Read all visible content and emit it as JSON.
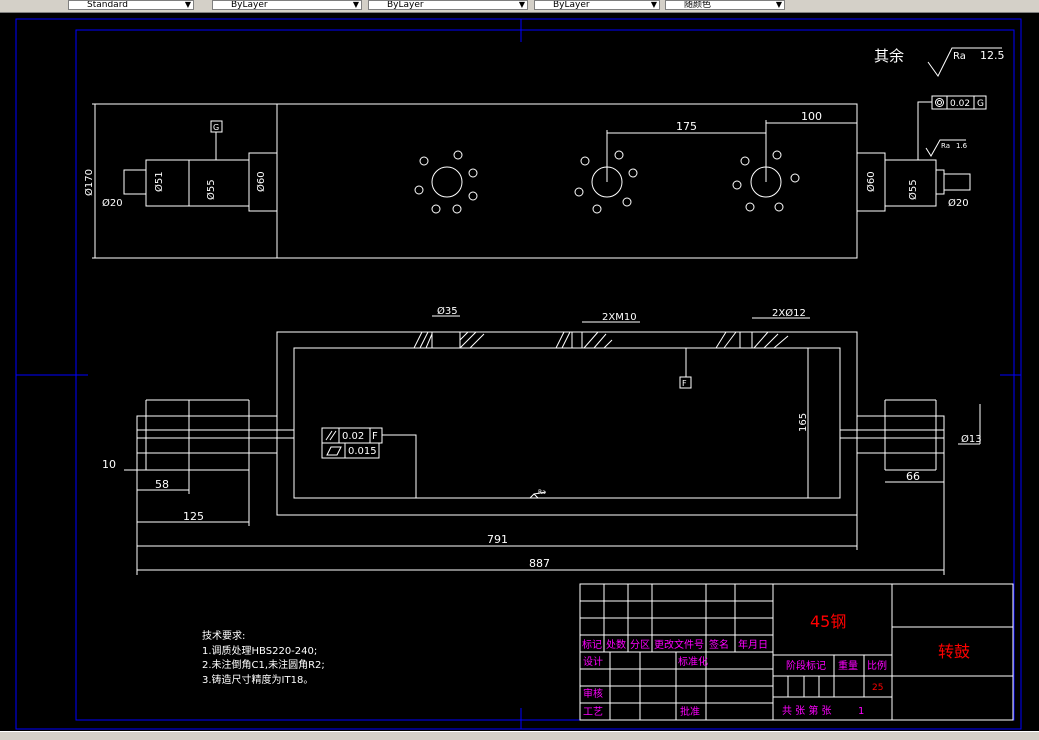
{
  "toolbar": {
    "combo1": "Standard",
    "combo2": "ByLayer",
    "combo3": "ByLayer",
    "combo4": "ByLayer",
    "combo5": "随颜色"
  },
  "roughness": {
    "other_label": "其余",
    "symbol": "Ra",
    "value": "12.5",
    "symbol2": "Ra",
    "value2": "1.6"
  },
  "datums": {
    "g": "G",
    "f": "F"
  },
  "top_view": {
    "d170": "Ø170",
    "d20_left": "Ø20",
    "d51": "Ø51",
    "d55_left": "Ø55",
    "d60_left": "Ø60",
    "d60_right": "Ø60",
    "d55_right": "Ø55",
    "d20_right": "Ø20",
    "spacing": "175",
    "offset": "100",
    "coax_tol": "0.02",
    "coax_datum": "G"
  },
  "section_view": {
    "hole_d35": "Ø35",
    "thread": "2XM10",
    "hole_d12": "2XØ12",
    "height": "165",
    "d13": "Ø13",
    "parallel_tol": "0.02",
    "parallel_datum": "F",
    "flatness_tol": "0.015",
    "len10": "10",
    "len58": "58",
    "len125": "125",
    "len66": "66",
    "len791": "791",
    "len887": "887"
  },
  "tech_notes": {
    "title": "技术要求:",
    "items": [
      "1.调质处理HBS220-240;",
      "2.未注倒角C1,未注圆角R2;",
      "3.铸造尺寸精度为IT18。"
    ]
  },
  "title_block": {
    "material": "45钢",
    "part_name": "转鼓",
    "headers": [
      "标记",
      "处数",
      "分区",
      "更改文件号",
      "签名",
      "年月日"
    ],
    "design": "设计",
    "standard": "标准化",
    "review": "审核",
    "process": "工艺",
    "approve": "批准",
    "stage_mark": "阶段标记",
    "weight": "重量",
    "scale": "比例",
    "scale_value": "25",
    "sheets": "共 张 第 张",
    "sheet_no": "1"
  }
}
